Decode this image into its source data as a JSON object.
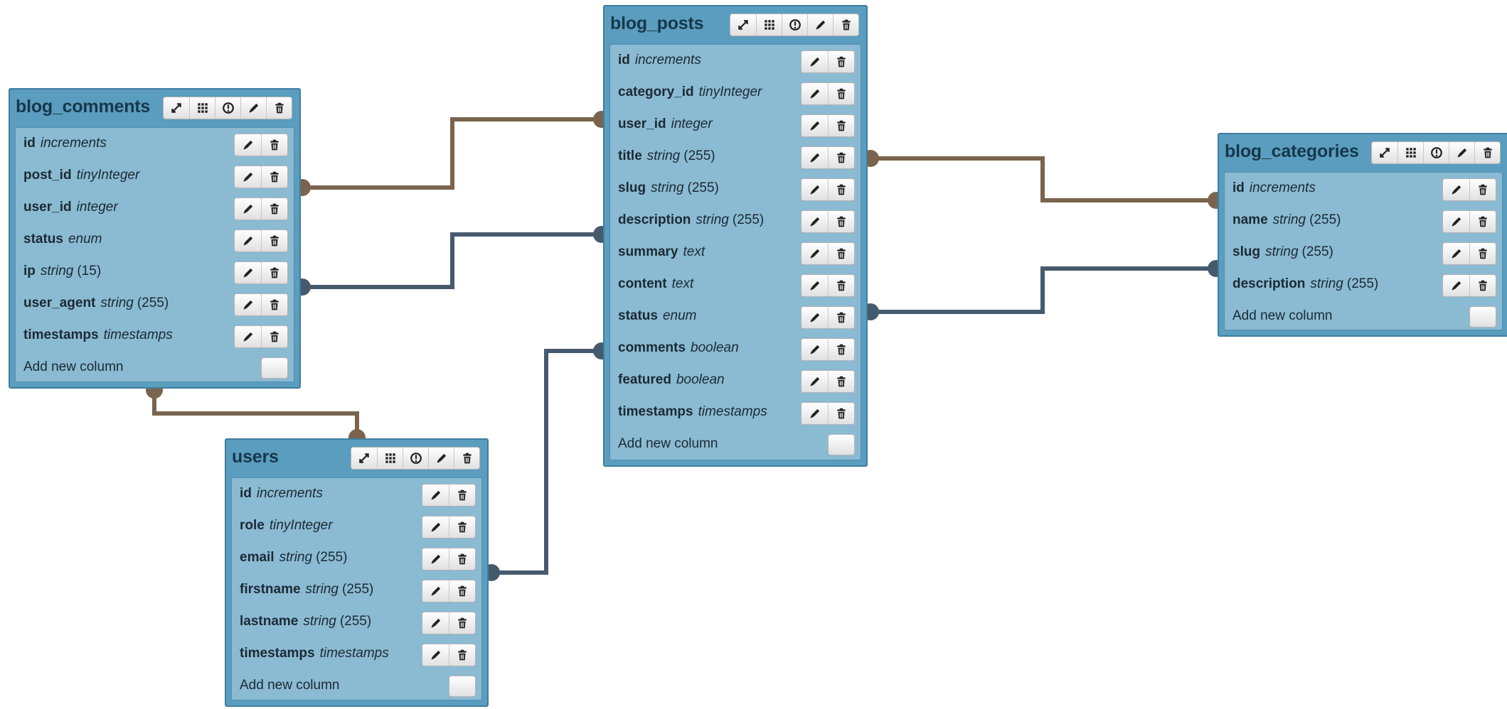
{
  "colors": {
    "relation_brown": "#7a644d",
    "relation_slate": "#465a6e",
    "table_frame": "#5b9dbf",
    "table_body": "#8bbad3"
  },
  "icons": {
    "header_tools": [
      "expand-icon",
      "grid-icon",
      "timestamp-icon",
      "pencil-icon",
      "trash-icon"
    ],
    "column_tools": [
      "pencil-icon",
      "trash-icon"
    ],
    "add_column": "plus-icon"
  },
  "tables": {
    "blog_comments": {
      "name": "blog_comments",
      "columns": [
        {
          "name": "id",
          "type": "increments",
          "length": ""
        },
        {
          "name": "post_id",
          "type": "tinyInteger",
          "length": ""
        },
        {
          "name": "user_id",
          "type": "integer",
          "length": ""
        },
        {
          "name": "status",
          "type": "enum",
          "length": ""
        },
        {
          "name": "ip",
          "type": "string",
          "length": "(15)"
        },
        {
          "name": "user_agent",
          "type": "string",
          "length": "(255)"
        },
        {
          "name": "timestamps",
          "type": "timestamps",
          "length": ""
        }
      ],
      "add_label": "Add new column"
    },
    "blog_posts": {
      "name": "blog_posts",
      "columns": [
        {
          "name": "id",
          "type": "increments",
          "length": ""
        },
        {
          "name": "category_id",
          "type": "tinyInteger",
          "length": ""
        },
        {
          "name": "user_id",
          "type": "integer",
          "length": ""
        },
        {
          "name": "title",
          "type": "string",
          "length": "(255)"
        },
        {
          "name": "slug",
          "type": "string",
          "length": "(255)"
        },
        {
          "name": "description",
          "type": "string",
          "length": "(255)"
        },
        {
          "name": "summary",
          "type": "text",
          "length": ""
        },
        {
          "name": "content",
          "type": "text",
          "length": ""
        },
        {
          "name": "status",
          "type": "enum",
          "length": ""
        },
        {
          "name": "comments",
          "type": "boolean",
          "length": ""
        },
        {
          "name": "featured",
          "type": "boolean",
          "length": ""
        },
        {
          "name": "timestamps",
          "type": "timestamps",
          "length": ""
        }
      ],
      "add_label": "Add new column"
    },
    "blog_categories": {
      "name": "blog_categories",
      "columns": [
        {
          "name": "id",
          "type": "increments",
          "length": ""
        },
        {
          "name": "name",
          "type": "string",
          "length": "(255)"
        },
        {
          "name": "slug",
          "type": "string",
          "length": "(255)"
        },
        {
          "name": "description",
          "type": "string",
          "length": "(255)"
        }
      ],
      "add_label": "Add new column"
    },
    "users": {
      "name": "users",
      "columns": [
        {
          "name": "id",
          "type": "increments",
          "length": ""
        },
        {
          "name": "role",
          "type": "tinyInteger",
          "length": ""
        },
        {
          "name": "email",
          "type": "string",
          "length": "(255)"
        },
        {
          "name": "firstname",
          "type": "string",
          "length": "(255)"
        },
        {
          "name": "lastname",
          "type": "string",
          "length": "(255)"
        },
        {
          "name": "timestamps",
          "type": "timestamps",
          "length": ""
        }
      ],
      "add_label": "Add new column"
    }
  }
}
